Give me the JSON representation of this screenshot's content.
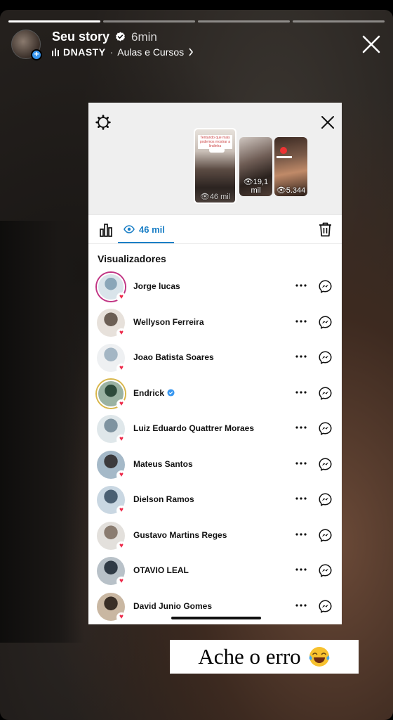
{
  "story": {
    "title": "Seu story",
    "time": "6min",
    "music_artist": "DNASTY",
    "music_sep": "·",
    "music_track": "Aulas e Cursos",
    "progress_segments": 4,
    "active_segments": 1
  },
  "viewer_sheet": {
    "thumbnails": [
      {
        "views": "46 mil",
        "caption": "Tentando que mais podemos mostrar a lindinha"
      },
      {
        "views": "19,1 mil"
      },
      {
        "views": "5.344"
      }
    ],
    "views_tab_label": "46 mil",
    "section_title": "Visualizadores",
    "viewers": [
      {
        "name": "Jorge lucas",
        "verified": false,
        "liked": true,
        "ring": "story"
      },
      {
        "name": "Wellyson Ferreira",
        "verified": false,
        "liked": true,
        "ring": "none"
      },
      {
        "name": "Joao Batista Soares",
        "verified": false,
        "liked": true,
        "ring": "none"
      },
      {
        "name": "Endrick",
        "verified": true,
        "liked": true,
        "ring": "gold"
      },
      {
        "name": "Luiz Eduardo Quattrer Moraes",
        "verified": false,
        "liked": true,
        "ring": "none"
      },
      {
        "name": "Mateus Santos",
        "verified": false,
        "liked": true,
        "ring": "none"
      },
      {
        "name": "Dielson Ramos",
        "verified": false,
        "liked": true,
        "ring": "none"
      },
      {
        "name": "Gustavo Martins Reges",
        "verified": false,
        "liked": true,
        "ring": "none"
      },
      {
        "name": "OTAVIO LEAL",
        "verified": false,
        "liked": true,
        "ring": "none"
      },
      {
        "name": "David Junio Gomes",
        "verified": false,
        "liked": true,
        "ring": "none"
      }
    ]
  },
  "caption": {
    "text": "Ache o erro",
    "emoji": "face-with-tears-of-joy"
  },
  "colors": {
    "accent_blue": "#1b7fc6",
    "heart_red": "#ed2a4a",
    "verified_blue": "#3897f0"
  }
}
